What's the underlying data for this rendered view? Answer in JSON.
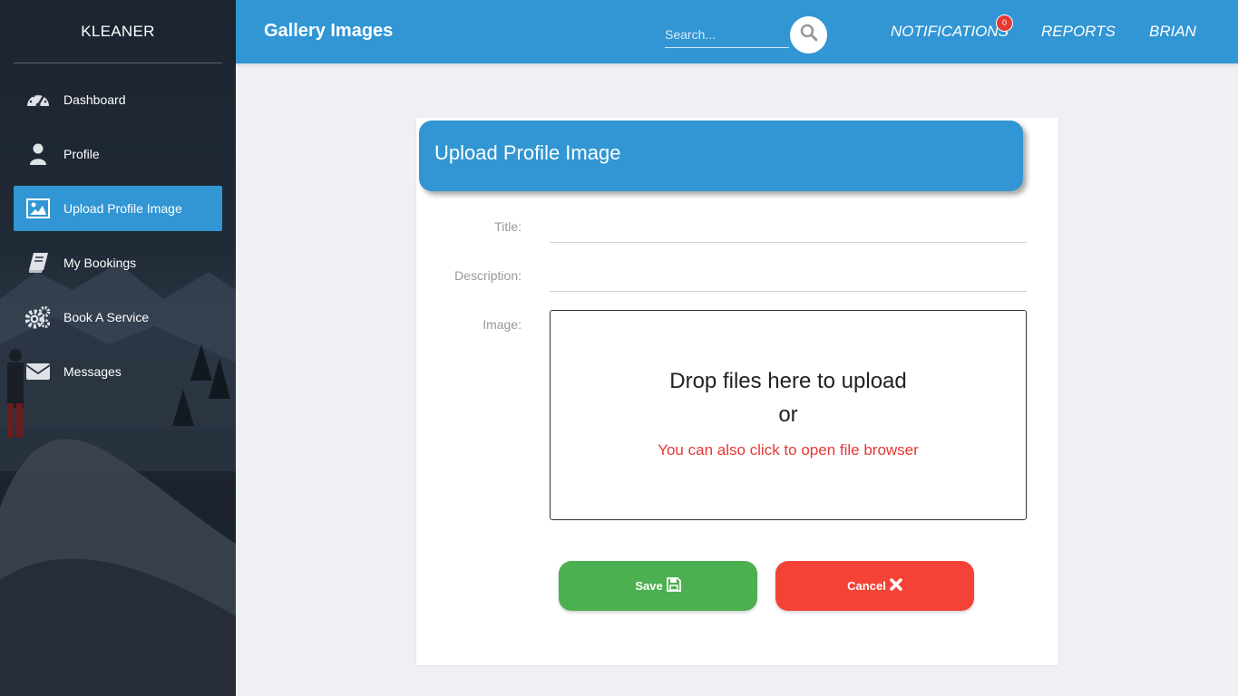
{
  "sidebar": {
    "brand": "KLEANER",
    "items": [
      {
        "label": "Dashboard",
        "icon": "dashboard-icon"
      },
      {
        "label": "Profile",
        "icon": "user-icon"
      },
      {
        "label": "Upload Profile Image",
        "icon": "image-icon",
        "active": true
      },
      {
        "label": "My Bookings",
        "icon": "book-icon"
      },
      {
        "label": "Book A Service",
        "icon": "gears-icon"
      },
      {
        "label": "Messages",
        "icon": "envelope-icon"
      }
    ]
  },
  "header": {
    "title": "Gallery Images",
    "search_placeholder": "Search...",
    "notifications_label": "NOTIFICATIONS",
    "notifications_count": "0",
    "reports_label": "REPORTS",
    "user_label": "BRIAN"
  },
  "form": {
    "title": "Upload Profile Image",
    "title_label": "Title:",
    "title_value": "",
    "description_label": "Description:",
    "description_value": "",
    "image_label": "Image:",
    "dropzone_main": "Drop files here to upload",
    "dropzone_or": "or",
    "dropzone_sub": "You can also click to open file browser",
    "save_label": "Save",
    "cancel_label": "Cancel"
  },
  "colors": {
    "primary": "#3196d3",
    "save": "#4caf50",
    "cancel": "#f44336",
    "badge": "#e53935"
  }
}
